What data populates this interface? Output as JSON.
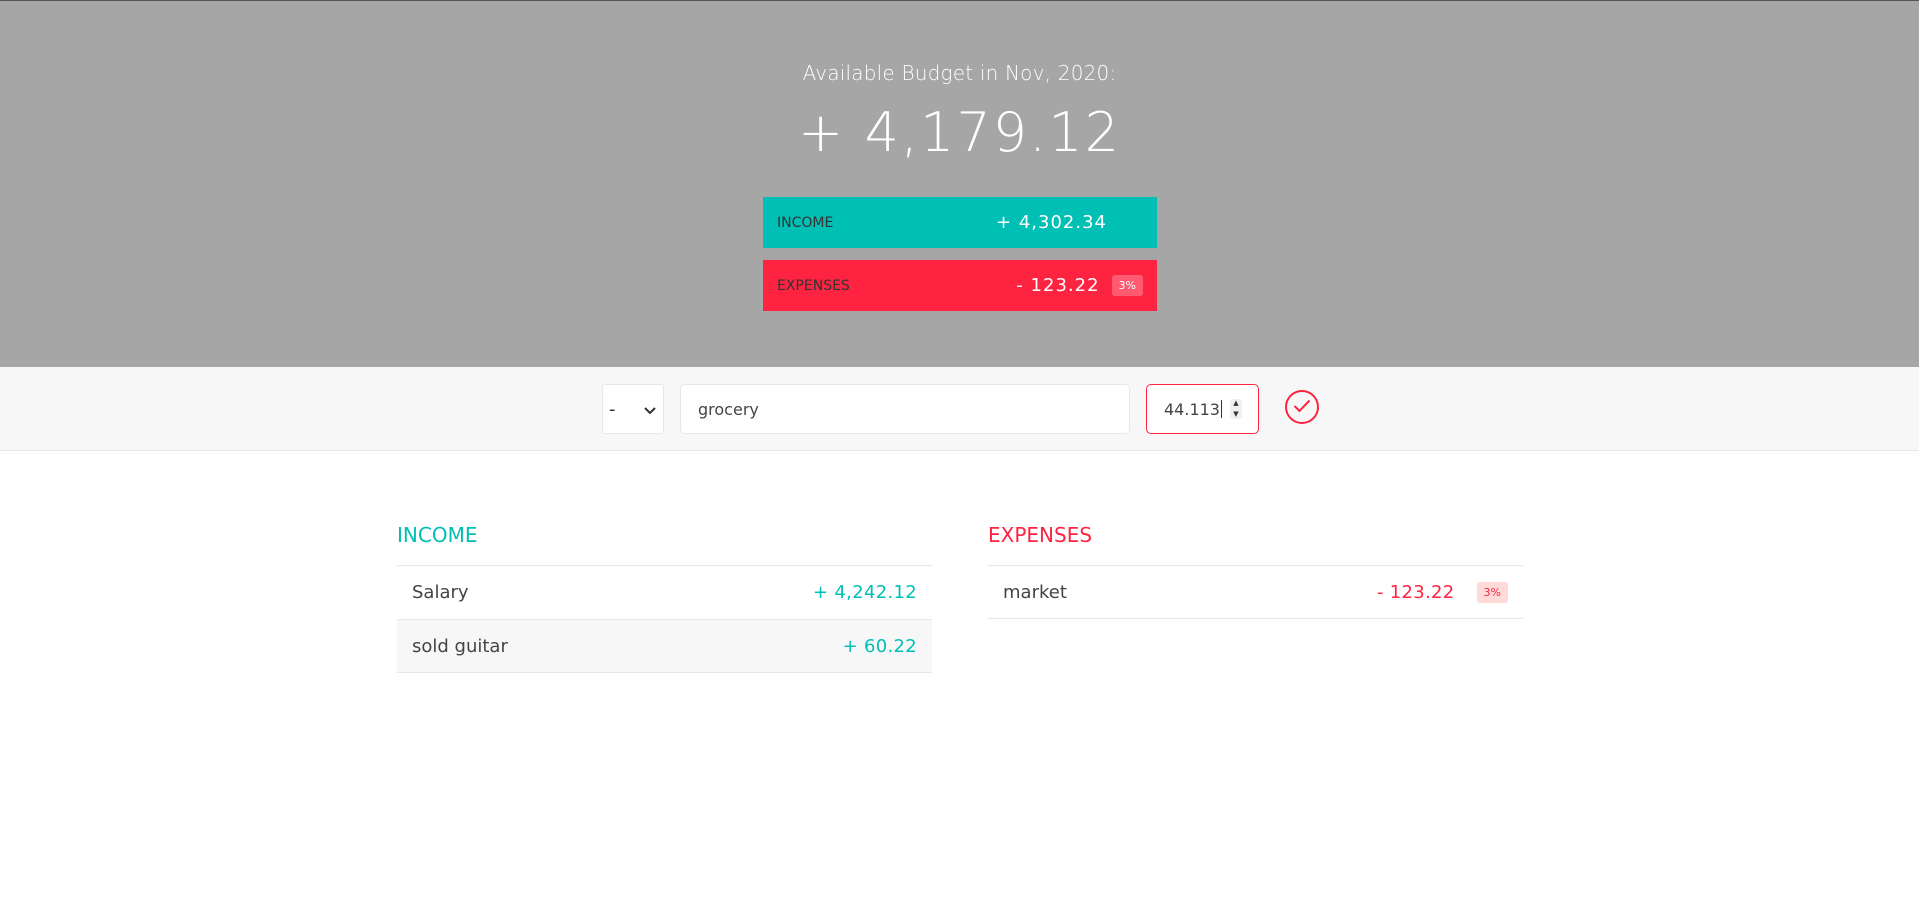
{
  "header": {
    "title": "Available Budget in Nov, 2020:",
    "budget": "+ 4,179.12",
    "income": {
      "label": "INCOME",
      "value": "+ 4,302.34"
    },
    "expenses": {
      "label": "EXPENSES",
      "value": "- 123.22",
      "percentage": "3%"
    }
  },
  "add_form": {
    "type_selected": "-",
    "description": "grocery",
    "value": "44.113"
  },
  "income_list": {
    "title": "INCOME",
    "items": [
      {
        "description": "Salary",
        "value": "+ 4,242.12"
      },
      {
        "description": "sold guitar",
        "value": "+ 60.22"
      }
    ]
  },
  "expenses_list": {
    "title": "EXPENSES",
    "items": [
      {
        "description": "market",
        "value": "- 123.22",
        "percentage": "3%"
      }
    ]
  },
  "colors": {
    "income": "#00bfb5",
    "expenses": "#ff2342",
    "header_bg": "#a6a6a6"
  },
  "icons": {
    "type_select": "chevron-down-icon",
    "submit": "checkmark-circle-icon",
    "spinner": "stepper-icon"
  }
}
